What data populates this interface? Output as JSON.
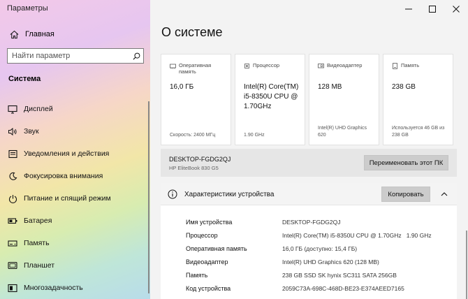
{
  "window": {
    "title": "Параметры",
    "controls": [
      "minimize-icon",
      "maximize-icon",
      "close-icon"
    ]
  },
  "sidebar": {
    "home_label": "Главная",
    "search_placeholder": "Найти параметр",
    "section": "Система",
    "items": [
      {
        "label": "Дисплей",
        "icon": "display-icon"
      },
      {
        "label": "Звук",
        "icon": "sound-icon"
      },
      {
        "label": "Уведомления и действия",
        "icon": "notifications-icon"
      },
      {
        "label": "Фокусировка внимания",
        "icon": "focus-assist-icon"
      },
      {
        "label": "Питание и спящий режим",
        "icon": "power-icon"
      },
      {
        "label": "Батарея",
        "icon": "battery-icon"
      },
      {
        "label": "Память",
        "icon": "storage-icon"
      },
      {
        "label": "Планшет",
        "icon": "tablet-icon"
      },
      {
        "label": "Многозадачность",
        "icon": "multitasking-icon"
      }
    ]
  },
  "main": {
    "title": "О системе",
    "cards": [
      {
        "title": "Оперативная память",
        "value": "16,0 ГБ",
        "sub": "Скорость: 2400 МГц",
        "icon": "ram-icon"
      },
      {
        "title": "Процессор",
        "value": "Intel(R) Core(TM) i5-8350U CPU @ 1.70GHz",
        "sub": "1.90 GHz",
        "icon": "processor-icon"
      },
      {
        "title": "Видеоадаптер",
        "value": "128 MB",
        "sub": "Intel(R) UHD Graphics 620",
        "icon": "gpu-icon"
      },
      {
        "title": "Память",
        "value": "238 GB",
        "sub": "Используется 46 GB из 238 GB",
        "icon": "storage-icon"
      }
    ],
    "pc": {
      "name": "DESKTOP-FGDG2QJ",
      "model": "HP EliteBook 830 G5",
      "rename_label": "Переименовать этот ПК"
    },
    "specs": {
      "title": "Характеристики устройства",
      "copy_label": "Копировать",
      "rows": [
        {
          "key": "Имя устройства",
          "value": "DESKTOP-FGDG2QJ"
        },
        {
          "key": "Процессор",
          "value": "Intel(R) Core(TM) i5-8350U CPU @ 1.70GHz   1.90 GHz"
        },
        {
          "key": "Оперативная память",
          "value": "16,0 ГБ (доступно: 15,4 ГБ)"
        },
        {
          "key": "Видеоадаптер",
          "value": "Intel(R) UHD Graphics 620 (128 MB)"
        },
        {
          "key": "Память",
          "value": "238 GB SSD SK hynix SC311 SATA 256GB"
        },
        {
          "key": "Код устройства",
          "value": "2059C73A-698C-468D-BE23-E374AEED7165"
        }
      ]
    }
  }
}
